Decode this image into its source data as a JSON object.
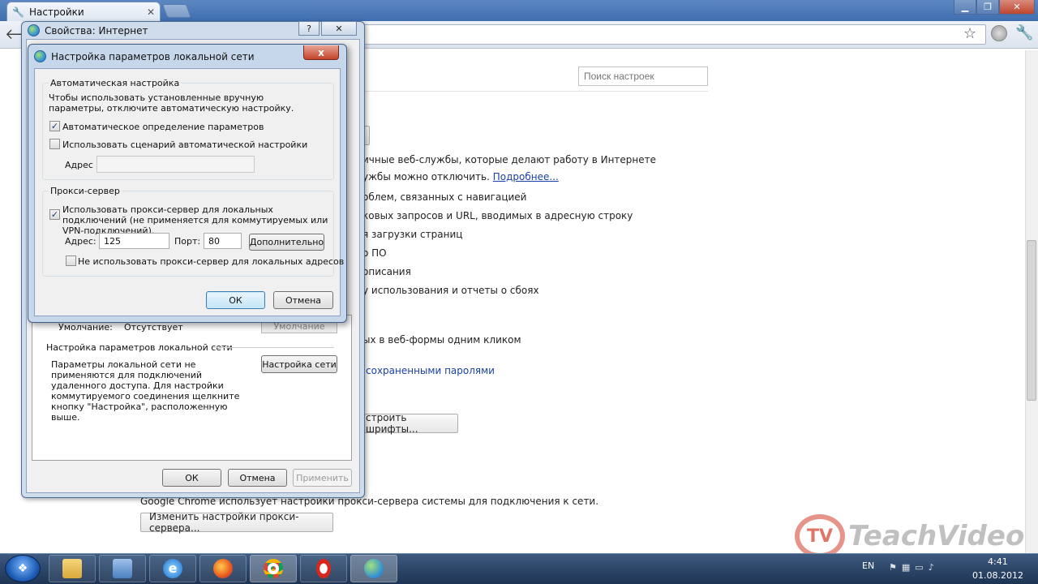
{
  "chrome": {
    "tab_title": "Настройки",
    "search_placeholder": "Поиск настроек"
  },
  "settings_bg": {
    "line1": "ичные веб-службы, которые делают работу в Интернете",
    "line2": "ужбы можно отключить.",
    "line2_link": "Подробнее...",
    "line3": "облем, связанных с навигацией",
    "line4": "ковых запросов и URL, вводимых в адресную строку",
    "line5": "я загрузки страниц",
    "line6": "о ПО",
    "line7": "описания",
    "line8": "у использования и отчеты о сбоях",
    "line9": "ых в веб-формы одним кликом",
    "line10": "сохраненными паролями",
    "fonts_button": "строить шрифты...",
    "proxy_note": "Google Chrome использует настройки прокси-сервера системы для подключения к сети.",
    "proxy_button": "Изменить настройки прокси-сервера..."
  },
  "inet_dialog": {
    "title": "Свойства: Интернет",
    "help_glyph": "?",
    "close_glyph": "✕",
    "default_label": "Умолчание:",
    "default_value": "Отсутствует",
    "default_button": "Умолчание",
    "lan_group": "Настройка параметров локальной сети",
    "lan_desc": "Параметры локальной сети не применяются для подключений удаленного доступа. Для настройки коммутируемого соединения щелкните кнопку \"Настройка\", расположенную выше.",
    "lan_button": "Настройка сети",
    "ok": "ОК",
    "cancel": "Отмена",
    "apply": "Применить"
  },
  "lan_dialog": {
    "title": "Настройка параметров локальной сети",
    "close_glyph": "x",
    "auto_group": "Автоматическая настройка",
    "auto_desc": "Чтобы использовать установленные вручную параметры, отключите автоматическую настройку.",
    "auto_detect": "Автоматическое определение параметров",
    "auto_detect_checked": true,
    "use_script": "Использовать сценарий автоматической настройки",
    "use_script_checked": false,
    "script_address_label": "Адрес",
    "script_address_value": "",
    "proxy_group": "Прокси-сервер",
    "use_proxy": "Использовать прокси-сервер для локальных подключений (не применяется для коммутируемых или VPN-подключений).",
    "use_proxy_checked": true,
    "address_label": "Адрес:",
    "address_value": "125",
    "port_label": "Порт:",
    "port_value": "80",
    "advanced_button": "Дополнительно",
    "bypass_local": "Не использовать прокси-сервер для локальных адресов",
    "bypass_local_checked": false,
    "ok": "ОК",
    "cancel": "Отмена",
    "check_glyph": "✓"
  },
  "taskbar": {
    "language": "EN",
    "time": "4:41",
    "date": "01.08.2012"
  },
  "watermark": {
    "brand": "TeachVideo",
    "mark": "TV"
  }
}
